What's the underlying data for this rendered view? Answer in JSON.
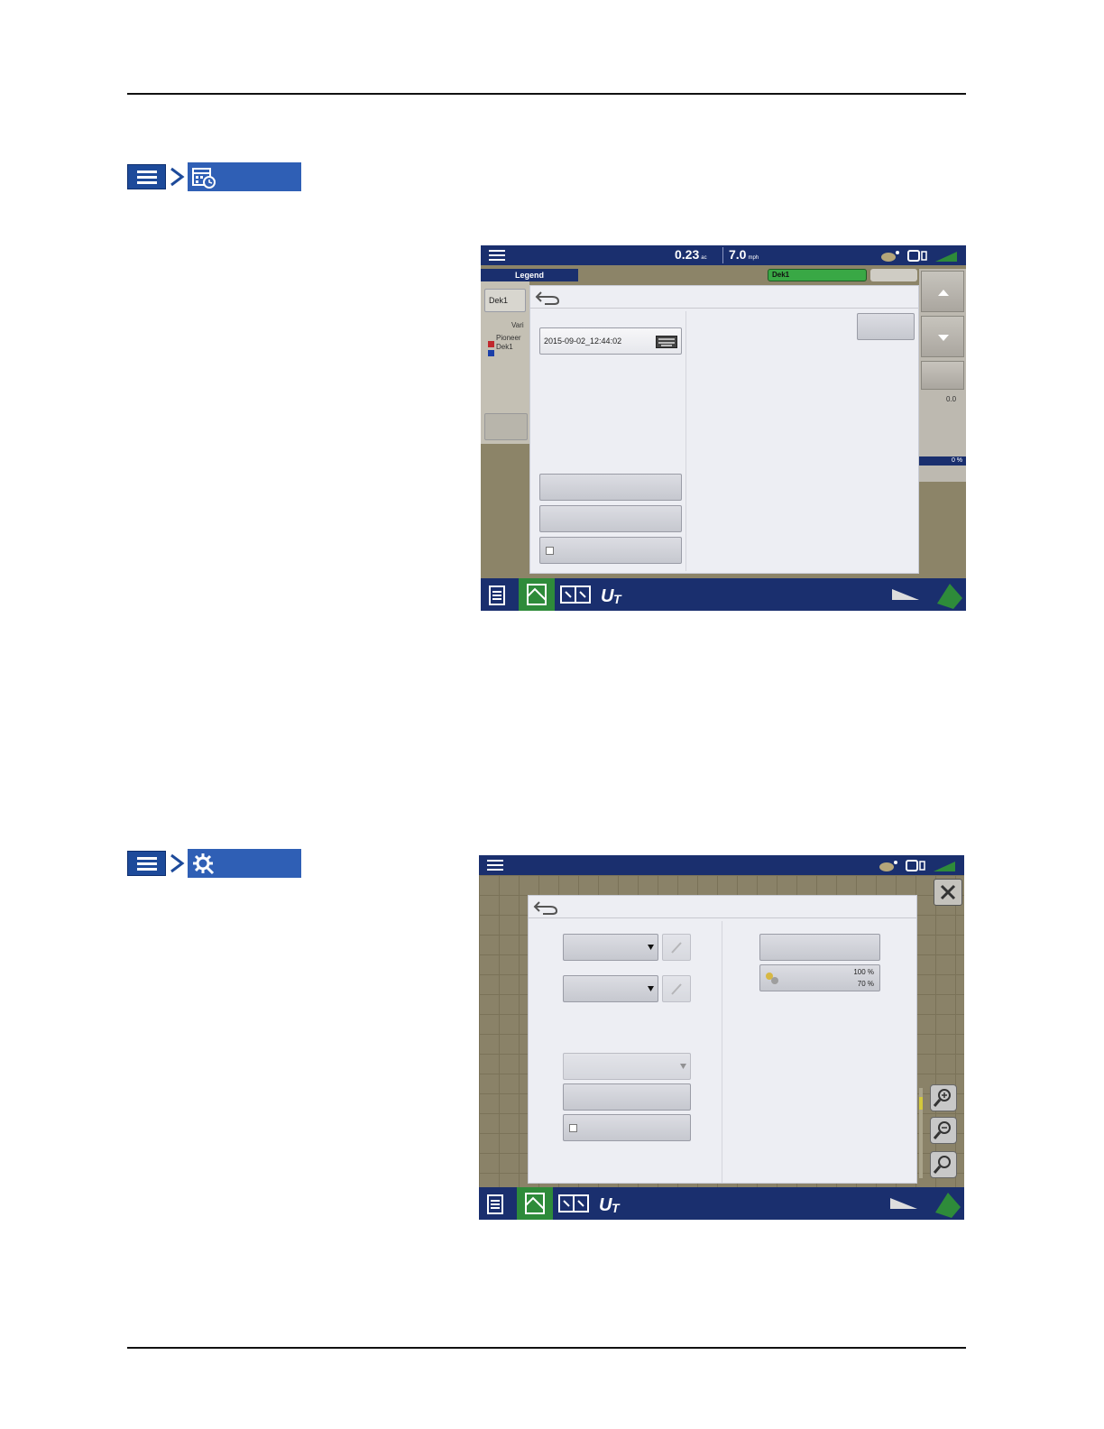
{
  "document": {
    "header_rule": true,
    "footer_rule": true
  },
  "screen1": {
    "topbar": {
      "area_value": "0.23",
      "area_unit": "ac",
      "speed_value": "7.0",
      "speed_unit": "mph"
    },
    "legend_tab": "Legend",
    "legend_field": "Dek1",
    "legend_label": "Vari",
    "legend_items": [
      {
        "label": "Pioneer",
        "color": "#c0282d"
      },
      {
        "label": "Dek1",
        "color": "#1b3fa8"
      }
    ],
    "green_tab": "Dek1",
    "right_readout_1": "0.0",
    "right_readout_2": "0 %",
    "dialog": {
      "name_field_value": "2015-09-02_12:44:02"
    }
  },
  "screen2": {
    "dialog": {
      "percent_1": "100 %",
      "percent_2": "70 %"
    }
  },
  "colors": {
    "nav_blue": "#1a2f6e",
    "tile_blue": "#2f5fb5",
    "active_green": "#2e8b3a"
  }
}
